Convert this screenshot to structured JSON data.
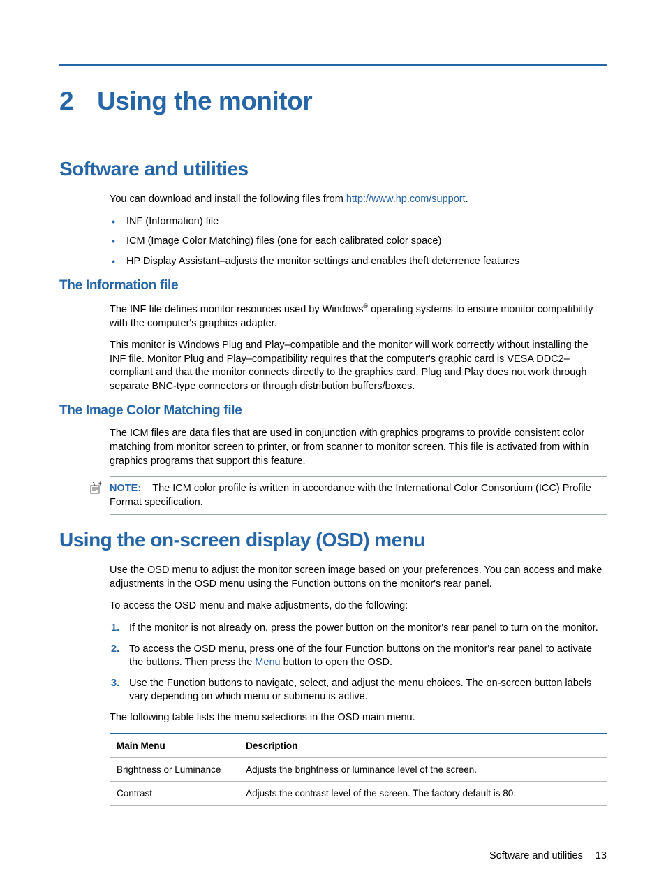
{
  "chapter": {
    "number": "2",
    "title": "Using the monitor"
  },
  "section1": {
    "title": "Software and utilities",
    "intro_pre": "You can download and install the following files from ",
    "intro_link": "http://www.hp.com/support",
    "intro_post": ".",
    "bullets": [
      "INF (Information) file",
      "ICM (Image Color Matching) files (one for each calibrated color space)",
      "HP Display Assistant–adjusts the monitor settings and enables theft deterrence features"
    ]
  },
  "subsection_info": {
    "title": "The Information file",
    "p1_pre": "The INF file defines monitor resources used by Windows",
    "p1_post": " operating systems to ensure monitor compatibility with the computer's graphics adapter.",
    "p2": "This monitor is Windows Plug and Play–compatible and the monitor will work correctly without installing the INF file. Monitor Plug and Play–compatibility requires that the computer's graphic card is VESA DDC2–compliant and that the monitor connects directly to the graphics card. Plug and Play does not work through separate BNC-type connectors or through distribution buffers/boxes."
  },
  "subsection_icm": {
    "title": "The Image Color Matching file",
    "p1": "The ICM files are data files that are used in conjunction with graphics programs to provide consistent color matching from monitor screen to printer, or from scanner to monitor screen. This file is activated from within graphics programs that support this feature.",
    "note_label": "NOTE:",
    "note_text": "The ICM color profile is written in accordance with the International Color Consortium (ICC) Profile Format specification."
  },
  "section_osd": {
    "title": "Using the on-screen display (OSD) menu",
    "p1": "Use the OSD menu to adjust the monitor screen image based on your preferences. You can access and make adjustments in the OSD menu using the Function buttons on the monitor's rear panel.",
    "p2": "To access the OSD menu and make adjustments, do the following:",
    "steps": {
      "s1": "If the monitor is not already on, press the power button on the monitor's rear panel to turn on the monitor.",
      "s2_pre": "To access the OSD menu, press one of the four Function buttons on the monitor's rear panel to activate the buttons. Then press the ",
      "s2_key": "Menu",
      "s2_post": " button to open the OSD.",
      "s3": "Use the Function buttons to navigate, select, and adjust the menu choices. The on-screen button labels vary depending on which menu or submenu is active."
    },
    "table_intro": "The following table lists the menu selections in the OSD main menu.",
    "table": {
      "headers": [
        "Main Menu",
        "Description"
      ],
      "rows": [
        {
          "menu": "Brightness or Luminance",
          "desc": "Adjusts the brightness or luminance level of the screen."
        },
        {
          "menu": "Contrast",
          "desc": "Adjusts the contrast level of the screen. The factory default is 80."
        }
      ]
    }
  },
  "footer": {
    "section": "Software and utilities",
    "page": "13"
  }
}
